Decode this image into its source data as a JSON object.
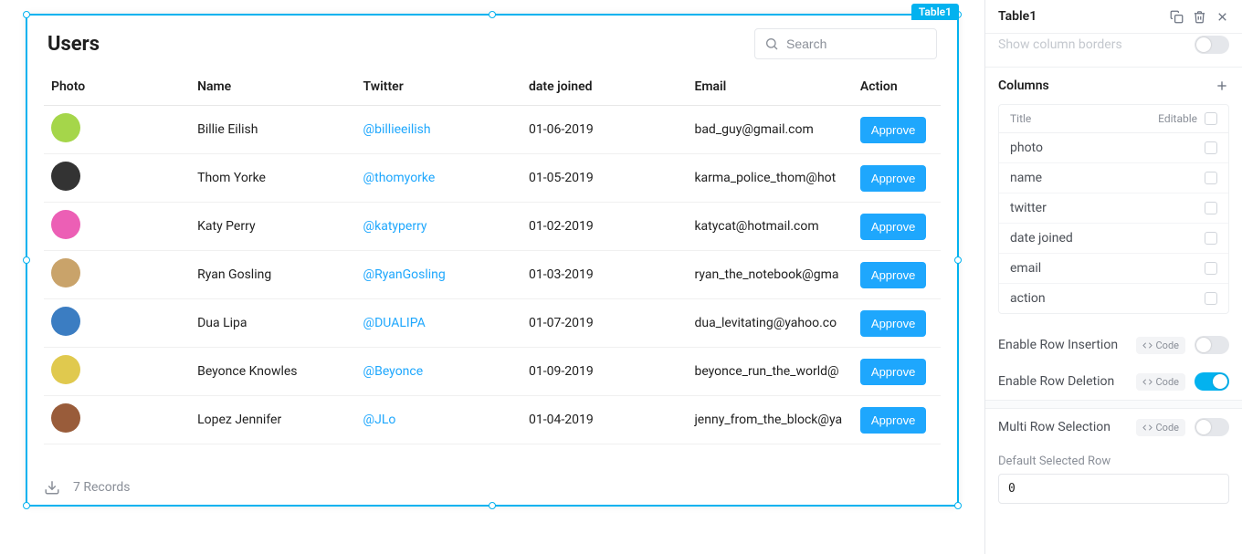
{
  "widget": {
    "label": "Table1",
    "title": "Users",
    "search_placeholder": "Search",
    "approve_label": "Approve",
    "footer": {
      "records_text": "7 Records"
    },
    "columns": {
      "photo": "Photo",
      "name": "Name",
      "twitter": "Twitter",
      "date": "date joined",
      "email": "Email",
      "action": "Action"
    },
    "avatars": [
      "#a5d64a",
      "#333333",
      "#ec5fb5",
      "#c9a36a",
      "#3b7dc2",
      "#e0c94e",
      "#995c3a"
    ],
    "rows": [
      {
        "name": "Billie Eilish",
        "twitter": "@billieeilish",
        "date": "01-06-2019",
        "email": "bad_guy@gmail.com"
      },
      {
        "name": "Thom Yorke",
        "twitter": "@thomyorke",
        "date": "01-05-2019",
        "email": "karma_police_thom@hot"
      },
      {
        "name": "Katy Perry",
        "twitter": "@katyperry",
        "date": "01-02-2019",
        "email": "katycat@hotmail.com"
      },
      {
        "name": "Ryan Gosling",
        "twitter": "@RyanGosling",
        "date": "01-03-2019",
        "email": "ryan_the_notebook@gma"
      },
      {
        "name": "Dua Lipa",
        "twitter": "@DUALIPA",
        "date": "01-07-2019",
        "email": "dua_levitating@yahoo.co"
      },
      {
        "name": "Beyonce Knowles",
        "twitter": "@Beyonce",
        "date": "01-09-2019",
        "email": "beyonce_run_the_world@"
      },
      {
        "name": "Lopez Jennifer",
        "twitter": "@JLo",
        "date": "01-04-2019",
        "email": "jenny_from_the_block@ya"
      }
    ]
  },
  "panel": {
    "title": "Table1",
    "partial_top_label": "Show column borders",
    "columns_section": {
      "heading": "Columns",
      "title_label": "Title",
      "editable_label": "Editable",
      "items": [
        "photo",
        "name",
        "twitter",
        "date joined",
        "email",
        "action"
      ]
    },
    "rows_section": {
      "enable_insertion": "Enable Row Insertion",
      "enable_deletion": "Enable Row Deletion",
      "multi_selection": "Multi Row Selection",
      "default_selected": "Default Selected Row",
      "default_selected_value": "0",
      "code_label": "Code"
    },
    "toggles": {
      "show_borders": false,
      "row_insertion": false,
      "row_deletion": true,
      "multi_selection": false
    }
  }
}
